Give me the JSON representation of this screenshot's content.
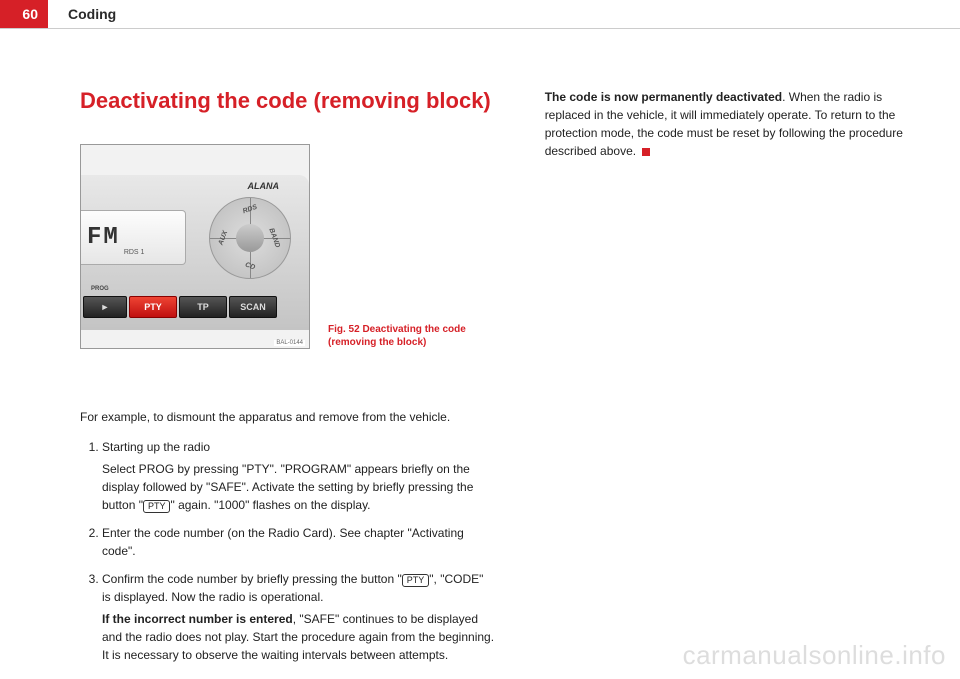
{
  "header": {
    "page_number": "60",
    "section": "Coding"
  },
  "left": {
    "heading": "Deactivating the code (removing block)",
    "figure": {
      "brand": "ALANA",
      "display_main": "FM",
      "display_sub": "RDS  1",
      "dpad": {
        "top": "RDS",
        "right": "BAND",
        "bottom": "CD",
        "left": "AUX"
      },
      "prog_label": "PROG",
      "buttons": {
        "play": "►",
        "pty": "PTY",
        "tp": "TP",
        "scan": "SCAN"
      },
      "img_code": "BAL-0144"
    },
    "caption": "Fig. 52  Deactivating the code (removing the block)",
    "intro": "For example, to dismount the apparatus and remove from the vehicle.",
    "steps": [
      {
        "title": "Starting up the radio",
        "body_pre": "Select PROG by pressing \"PTY\". \"PROGRAM\" appears briefly on the display followed by \"SAFE\". Activate the setting by briefly pressing the button \"",
        "pty": "PTY",
        "body_post": "\" again. \"1000\" flashes on the display."
      },
      {
        "title": "Enter the code number (on the Radio Card). See chapter \"Activating code\"."
      },
      {
        "title_pre": "Confirm the code number by briefly pressing the button \"",
        "pty": "PTY",
        "title_post": "\", \"CODE\" is displayed. Now the radio is operational.",
        "body_bold": "If the incorrect number is entered",
        "body_rest": ", \"SAFE\" continues to be displayed and the radio does not play. Start the procedure again from the beginning. It is necessary to observe the waiting intervals between attempts."
      }
    ]
  },
  "right": {
    "para_bold": "The code is now permanently deactivated",
    "para_rest": ". When the radio is replaced in the vehicle, it will immediately operate. To return to the protection mode, the code must be reset by following the procedure described above."
  },
  "watermark": "carmanualsonline.info"
}
